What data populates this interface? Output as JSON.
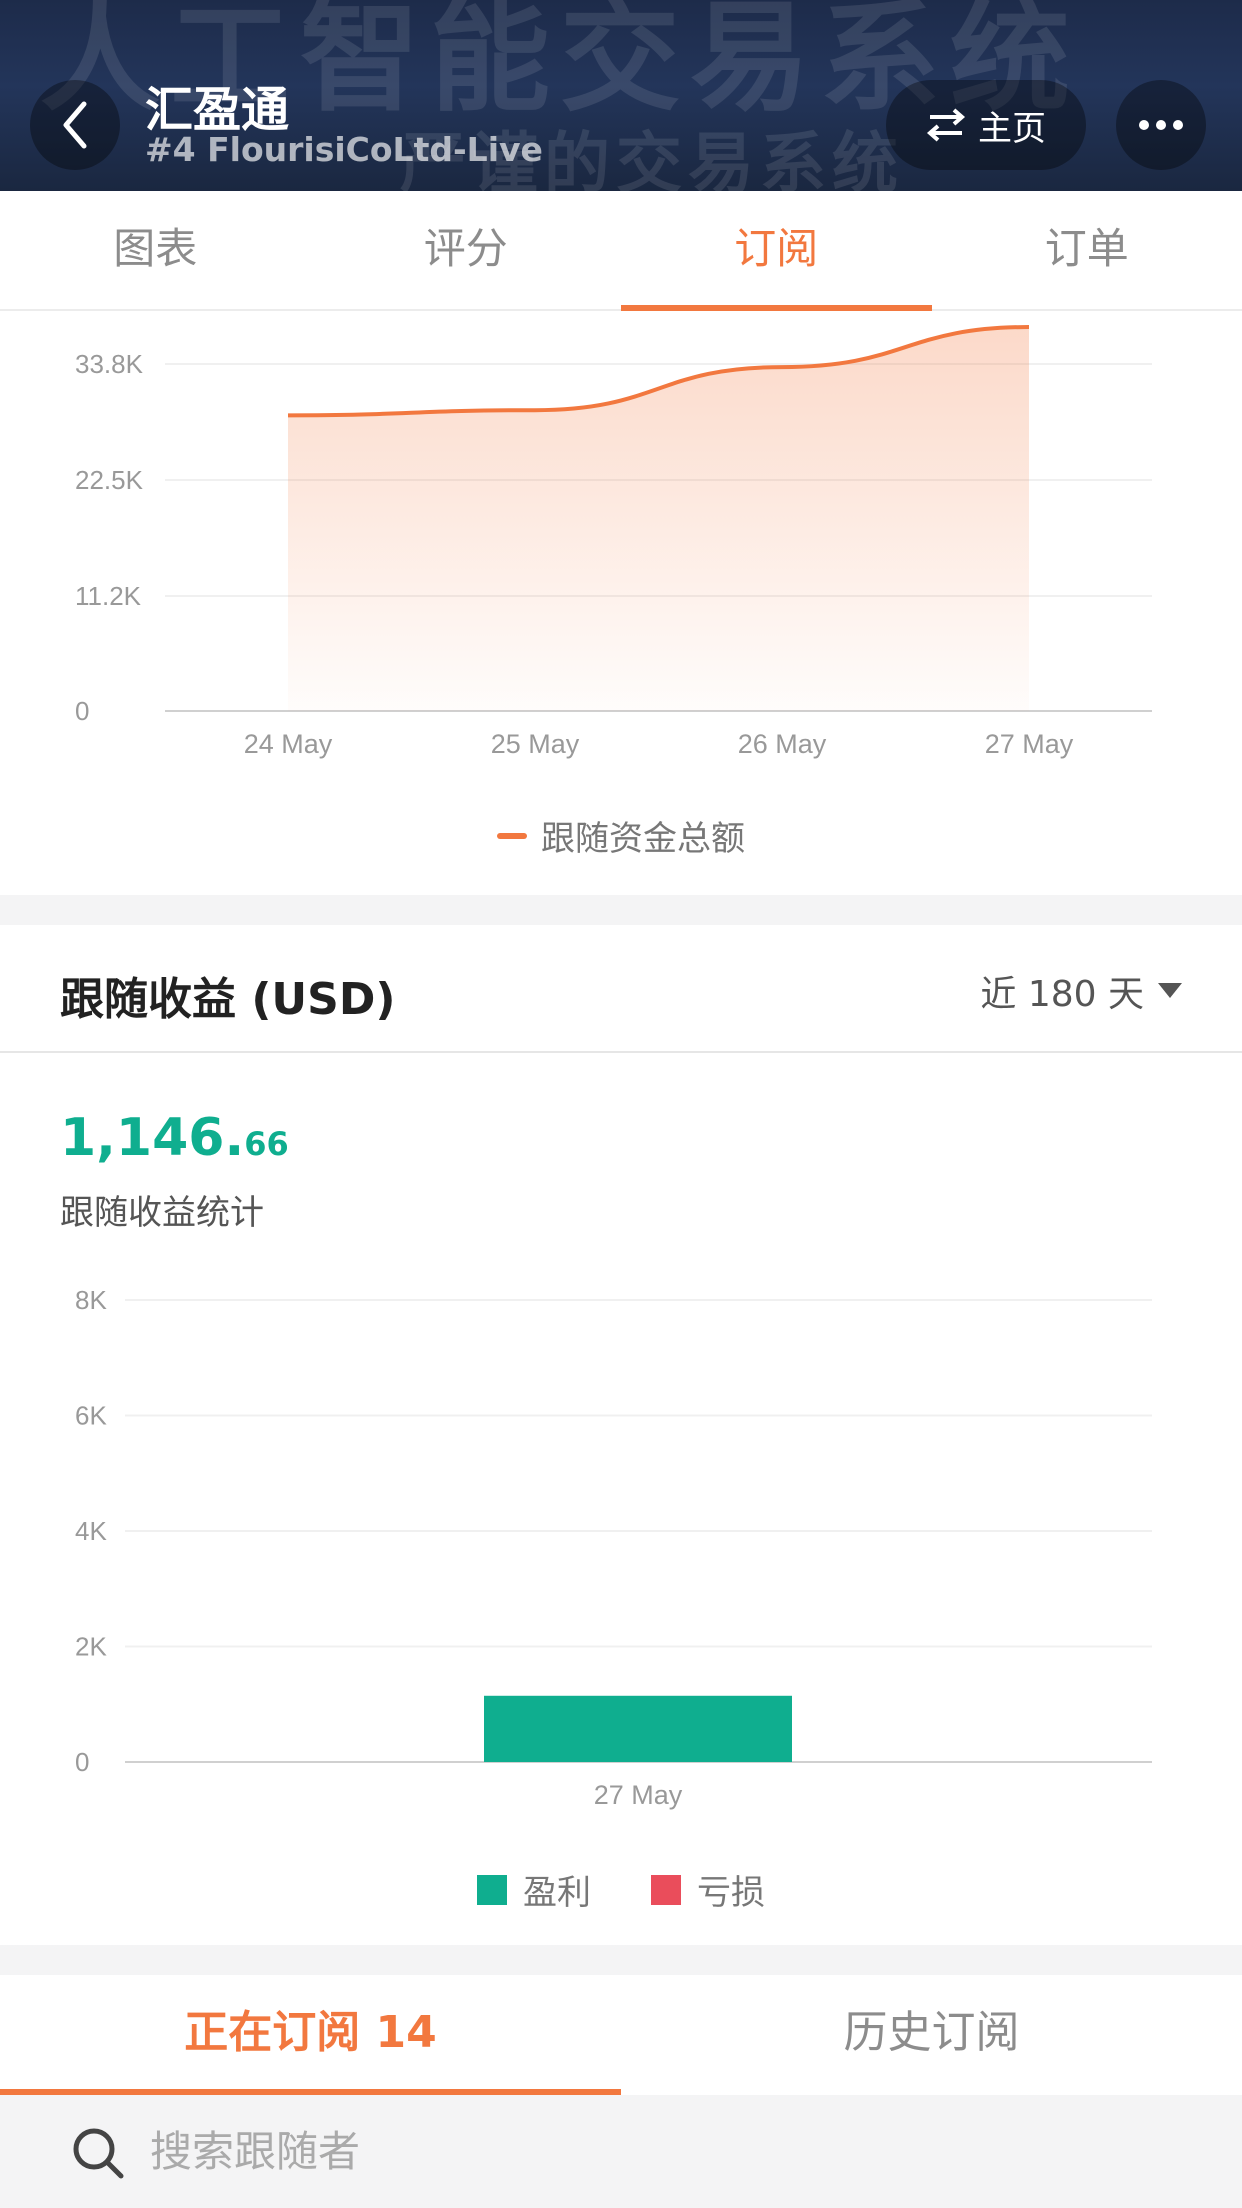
{
  "header": {
    "bg_text_1": "人工智能交易系统",
    "bg_text_2": "严谨的交易系统",
    "title": "汇盈通",
    "subtitle": "#4 FlourisiCoLtd-Live",
    "home_label": "主页"
  },
  "tabs": [
    {
      "label": "图表",
      "active": false
    },
    {
      "label": "评分",
      "active": false
    },
    {
      "label": "订阅",
      "active": true
    },
    {
      "label": "订单",
      "active": false
    }
  ],
  "follow_funds": {
    "legend": "跟随资金总额"
  },
  "profit_section": {
    "title": "跟随收益 (USD)",
    "period": "近 180 天",
    "total_int": "1,146.",
    "total_dec": "66",
    "total_label": "跟随收益统计",
    "legend_profit": "盈利",
    "legend_loss": "亏损"
  },
  "colors": {
    "accent": "#f2783f",
    "profit": "#0fae8f",
    "loss": "#ea4d5b"
  },
  "chart_data": [
    {
      "type": "area",
      "x": [
        "24 May",
        "25 May",
        "26 May",
        "27 May"
      ],
      "ytick_labels": [
        "0",
        "11.2K",
        "22.5K",
        "33.8K"
      ],
      "yticks": [
        0,
        11200,
        22500,
        33800
      ],
      "ylim": [
        0,
        37500
      ],
      "series": [
        {
          "name": "跟随资金总额",
          "values": [
            28800,
            29300,
            33500,
            37400
          ]
        }
      ],
      "grid": true,
      "legend_position": "bottom"
    },
    {
      "type": "bar",
      "categories": [
        "27 May"
      ],
      "ytick_labels": [
        "0",
        "2K",
        "4K",
        "6K",
        "8K"
      ],
      "yticks": [
        0,
        2000,
        4000,
        6000,
        8000
      ],
      "ylim": [
        0,
        8000
      ],
      "series": [
        {
          "name": "盈利",
          "values": [
            1146.66
          ]
        },
        {
          "name": "亏损",
          "values": [
            0
          ]
        }
      ],
      "grid": true,
      "legend_position": "bottom"
    }
  ],
  "subscription_tabs": [
    {
      "label": "正在订阅 14",
      "active": true
    },
    {
      "label": "历史订阅",
      "active": false
    }
  ],
  "search": {
    "placeholder": "搜索跟随者"
  }
}
